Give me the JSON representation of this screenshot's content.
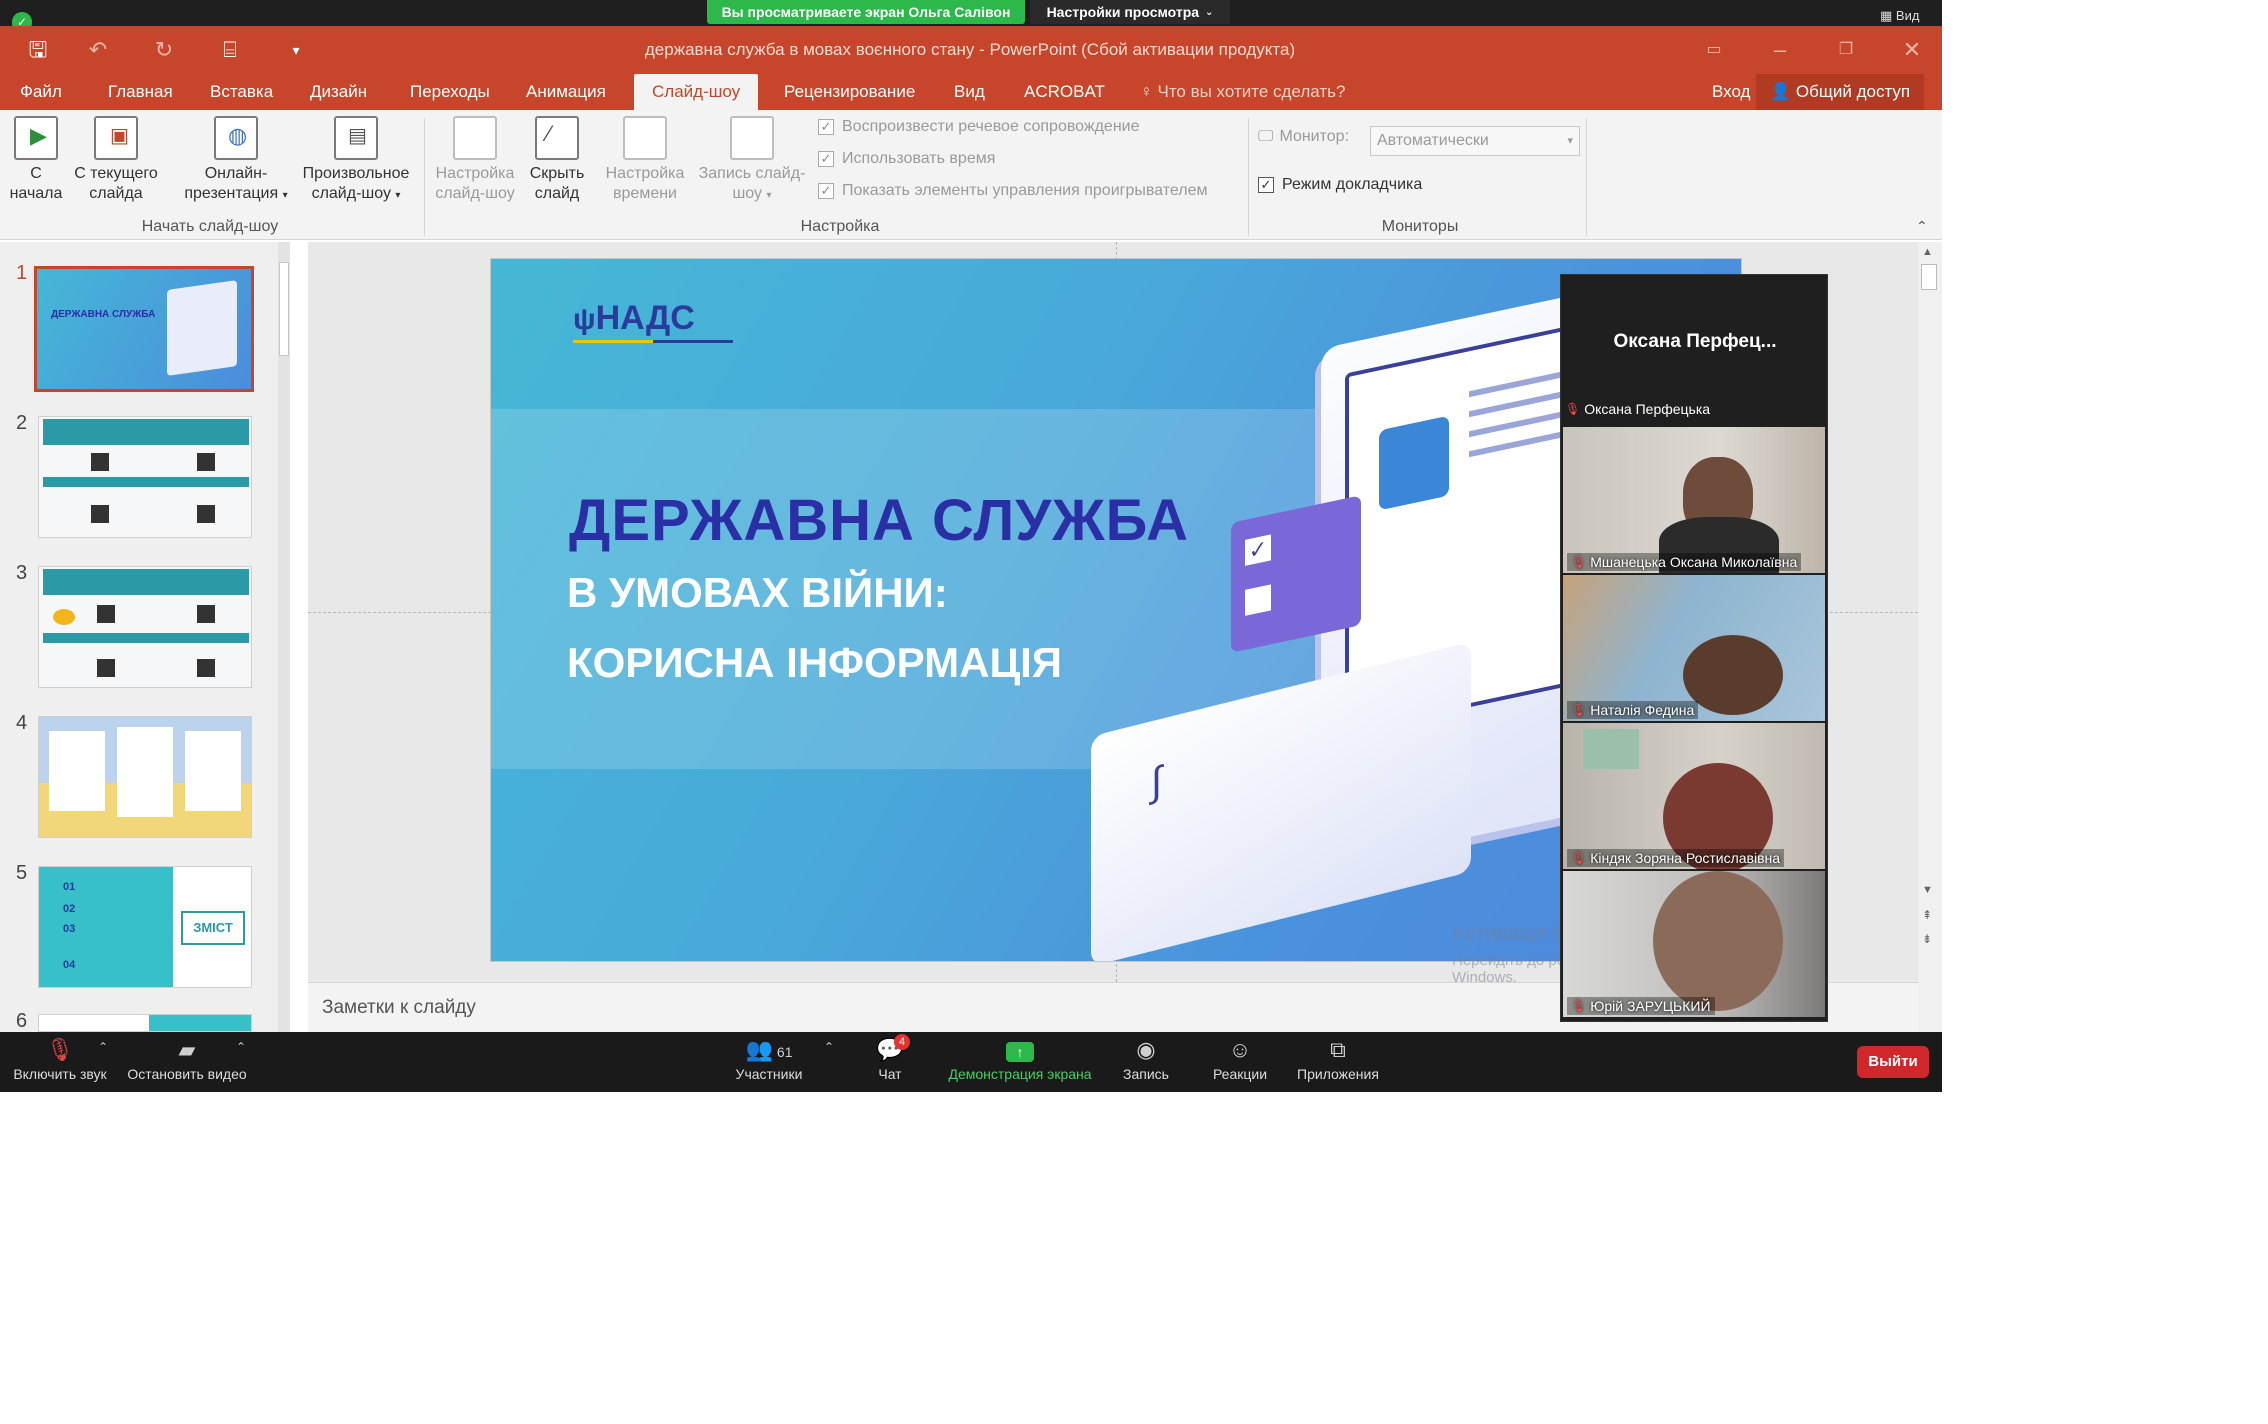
{
  "zoom_top": {
    "share_banner": "Вы просматриваете экран Ольга Салівон",
    "view_settings": "Настройки просмотра",
    "view_button": "Вид"
  },
  "window": {
    "title": "державна служба в мовах воєнного стану - PowerPoint (Сбой активации продукта)"
  },
  "tabs": [
    "Файл",
    "Главная",
    "Вставка",
    "Дизайн",
    "Переходы",
    "Анимация",
    "Слайд-шоу",
    "Рецензирование",
    "Вид",
    "ACROBAT"
  ],
  "tell_me": "Что вы хотите сделать?",
  "signin": "Вход",
  "share": "Общий доступ",
  "ribbon": {
    "start_group": {
      "label": "Начать слайд-шоу",
      "btn_from_start": [
        "С",
        "начала"
      ],
      "btn_from_current": [
        "С текущего",
        "слайда"
      ],
      "btn_online": [
        "Онлайн-",
        "презентация"
      ],
      "btn_custom": [
        "Произвольное",
        "слайд-шоу"
      ]
    },
    "setup_group": {
      "label": "Настройка",
      "btn_setup": [
        "Настройка",
        "слайд-шоу"
      ],
      "btn_hide": [
        "Скрыть",
        "слайд"
      ],
      "btn_timings": [
        "Настройка",
        "времени"
      ],
      "btn_record": [
        "Запись слайд-",
        "шоу"
      ],
      "chk_narration": "Воспроизвести речевое сопровождение",
      "chk_timings": "Использовать время",
      "chk_controls": "Показать элементы управления проигрывателем"
    },
    "monitors_group": {
      "label": "Мониторы",
      "monitor_label": "Монитор:",
      "monitor_value": "Автоматически",
      "presenter_view": "Режим докладчика"
    }
  },
  "thumbnails": [
    "1",
    "2",
    "3",
    "4",
    "5",
    "6"
  ],
  "thumb_text": {
    "t1_title": "ДЕРЖАВНА СЛУЖБА",
    "t5_zmist": "ЗМІСТ",
    "t5_nums": [
      "01",
      "02",
      "03",
      "04"
    ]
  },
  "slide": {
    "logo": "НАДС",
    "title_line1": "ДЕРЖАВНА СЛУЖБА",
    "title_line2": "В УМОВАХ ВІЙНИ:",
    "title_line3": "КОРИСНА ІНФОРМАЦІЯ"
  },
  "notes_placeholder": "Заметки к слайду",
  "watermark": {
    "line1": "Активація Windows",
    "line2": "Перейдіть до розділу \"Настройки\", щоб активувати Windows."
  },
  "video": {
    "speaker_header": "Оксана  Перфец...",
    "participants": [
      "Оксана Перфецька",
      "Мшанецька Оксана Миколаївна",
      "Наталія Федина",
      "Кіндяк Зоряна Ростиславівна",
      "Юрій ЗАРУЦЬКИЙ"
    ]
  },
  "toolbar": {
    "unmute": "Включить звук",
    "stop_video": "Остановить видео",
    "participants": "Участники",
    "participants_count": "61",
    "chat": "Чат",
    "chat_badge": "4",
    "share_screen": "Демонстрация экрана",
    "record": "Запись",
    "reactions": "Реакции",
    "apps": "Приложения",
    "leave": "Выйти"
  }
}
